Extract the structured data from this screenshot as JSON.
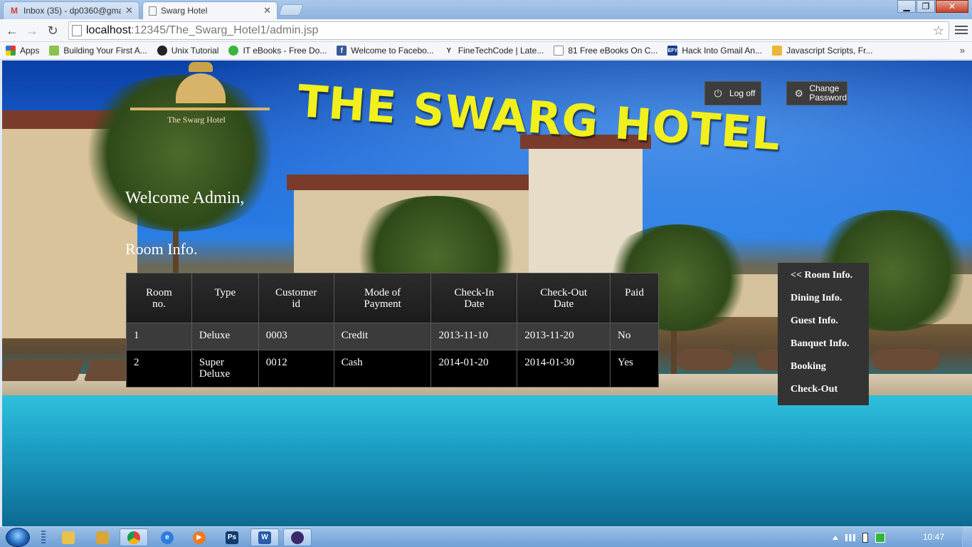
{
  "browser": {
    "tabs": [
      {
        "title": "Inbox (35) - dp0360@gma",
        "icon": "gmail-icon",
        "active": false
      },
      {
        "title": "Swarg Hotel",
        "icon": "page-icon",
        "active": true
      }
    ],
    "address": {
      "host": "localhost",
      "path": ":12345/The_Swarg_Hotel1/admin.jsp"
    },
    "bookmarks": [
      {
        "label": "Apps",
        "icon": "apps-grid-icon"
      },
      {
        "label": "Building Your First A...",
        "icon": "android-icon"
      },
      {
        "label": "Unix Tutorial",
        "icon": "tux-icon"
      },
      {
        "label": "IT eBooks - Free Do...",
        "icon": "green-dot-icon"
      },
      {
        "label": "Welcome to Facebo...",
        "icon": "facebook-icon"
      },
      {
        "label": "FineTechCode | Late...",
        "icon": "ftc-icon"
      },
      {
        "label": "81 Free eBooks On C...",
        "icon": "page-icon"
      },
      {
        "label": "Hack Into Gmail An...",
        "icon": "efy-icon"
      },
      {
        "label": "Javascript Scripts, Fr...",
        "icon": "js-icon"
      }
    ]
  },
  "page": {
    "logo_name": "The Swarg Hotel",
    "hotel_title": "THE SWARG HOTEL",
    "logoff_label": "Log off",
    "change_password_line1": "Change",
    "change_password_line2": "Password",
    "welcome": "Welcome Admin,",
    "section_title": "Room Info.",
    "table": {
      "headers": [
        [
          "Room",
          "no."
        ],
        [
          "Type"
        ],
        [
          "Customer",
          "id"
        ],
        [
          "Mode of",
          "Payment"
        ],
        [
          "Check-In",
          "Date"
        ],
        [
          "Check-Out",
          "Date"
        ],
        [
          "Paid"
        ]
      ],
      "rows": [
        [
          "1",
          "Deluxe",
          "0003",
          "Credit",
          "2013-11-10",
          "2013-11-20",
          "No"
        ],
        [
          "2",
          "Super Deluxe",
          "0012",
          "Cash",
          "2014-01-20",
          "2014-01-30",
          "Yes"
        ]
      ]
    },
    "side_menu": [
      "<< Room Info.",
      "Dining Info.",
      "Guest Info.",
      "Banquet Info.",
      "Booking",
      "Check-Out"
    ]
  },
  "taskbar": {
    "clock": "10:47",
    "apps": [
      "explorer-icon",
      "windows-icon",
      "chrome-icon",
      "ie-icon",
      "media-player-icon",
      "photoshop-icon",
      "word-icon",
      "eclipse-icon"
    ]
  },
  "colors": {
    "title_yellow": "#f1f01c",
    "menu_bg": "#333333",
    "table_header_bg": "#2c2c2c",
    "row1_bg": "#3b3b3b",
    "row2_bg": "#000000"
  }
}
